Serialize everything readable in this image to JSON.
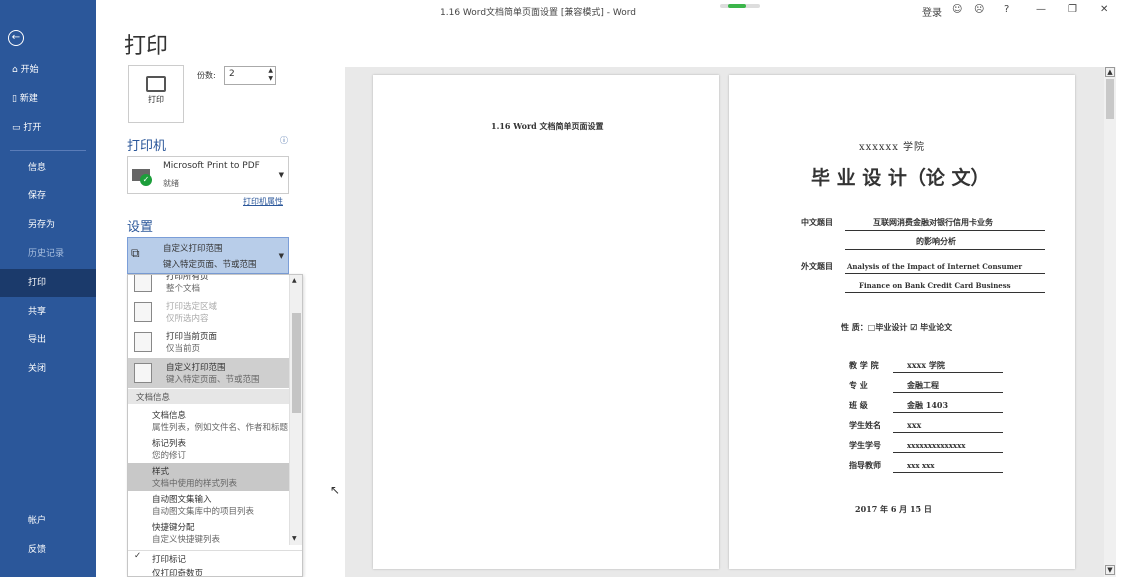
{
  "window": {
    "title": "1.16 Word文档简单页面设置 [兼容模式]  -  Word",
    "login": "登录",
    "help": "?"
  },
  "sidebar": {
    "items": [
      {
        "label": "开始",
        "icon": "home-icon"
      },
      {
        "label": "新建",
        "icon": "new-doc-icon"
      },
      {
        "label": "打开",
        "icon": "open-folder-icon"
      },
      {
        "label": "信息"
      },
      {
        "label": "保存"
      },
      {
        "label": "另存为"
      },
      {
        "label": "历史记录"
      },
      {
        "label": "打印"
      },
      {
        "label": "共享"
      },
      {
        "label": "导出"
      },
      {
        "label": "关闭"
      },
      {
        "label": "帐户"
      },
      {
        "label": "反馈"
      }
    ]
  },
  "print": {
    "heading": "打印",
    "button_label": "打印",
    "copies_label": "份数:",
    "copies_value": "2"
  },
  "printer": {
    "section": "打印机",
    "name": "Microsoft Print to PDF",
    "status": "就绪",
    "properties_link": "打印机属性"
  },
  "settings": {
    "section": "设置",
    "selected_title": "自定义打印范围",
    "selected_desc": "键入特定页面、节或范围"
  },
  "dropdown": {
    "options": [
      {
        "t1": "打印所有页",
        "t2": "整个文档"
      },
      {
        "t1": "打印选定区域",
        "t2": "仅所选内容"
      },
      {
        "t1": "打印当前页面",
        "t2": "仅当前页"
      },
      {
        "t1": "自定义打印范围",
        "t2": "键入特定页面、节或范围"
      }
    ],
    "group_header": "文档信息",
    "sub_items": [
      {
        "t1": "文档信息",
        "t2": "属性列表，例如文件名、作者和标题"
      },
      {
        "t1": "标记列表",
        "t2": "您的修订"
      },
      {
        "t1": "样式",
        "t2": "文档中使用的样式列表"
      },
      {
        "t1": "自动图文集输入",
        "t2": "自动图文集库中的项目列表"
      },
      {
        "t1": "快捷键分配",
        "t2": "自定义快捷键列表"
      }
    ],
    "checks": [
      {
        "mark": "✓",
        "label": "打印标记"
      },
      {
        "mark": "",
        "label": "仅打印奇数页"
      }
    ]
  },
  "preview": {
    "left_page_title": "1.16 Word 文档简单页面设置",
    "school": "xxxxxx 学院",
    "big_title": "毕 业 设 计（论 文）",
    "cn_title_label": "中文题目",
    "cn_title_line1": "互联网消费金融对银行信用卡业务",
    "cn_title_line2": "的影响分析",
    "en_title_label": "外文题目",
    "en_title_line1": "Analysis of the Impact of Internet Consumer",
    "en_title_line2": "Finance on Bank Credit Card Business",
    "nature": "性    质：□毕业设计  ☑  毕业论文",
    "fields": [
      {
        "label": "教 学 院",
        "value": "xxxx 学院"
      },
      {
        "label": "专     业",
        "value": "金融工程"
      },
      {
        "label": "班     级",
        "value": "金融 1403"
      },
      {
        "label": "学生姓名",
        "value": "xxx"
      },
      {
        "label": "学生学号",
        "value": "xxxxxxxxxxxxxx"
      },
      {
        "label": "指导教师",
        "value": "xxx  xxx"
      }
    ],
    "date": "2017 年   6   月   15   日"
  }
}
